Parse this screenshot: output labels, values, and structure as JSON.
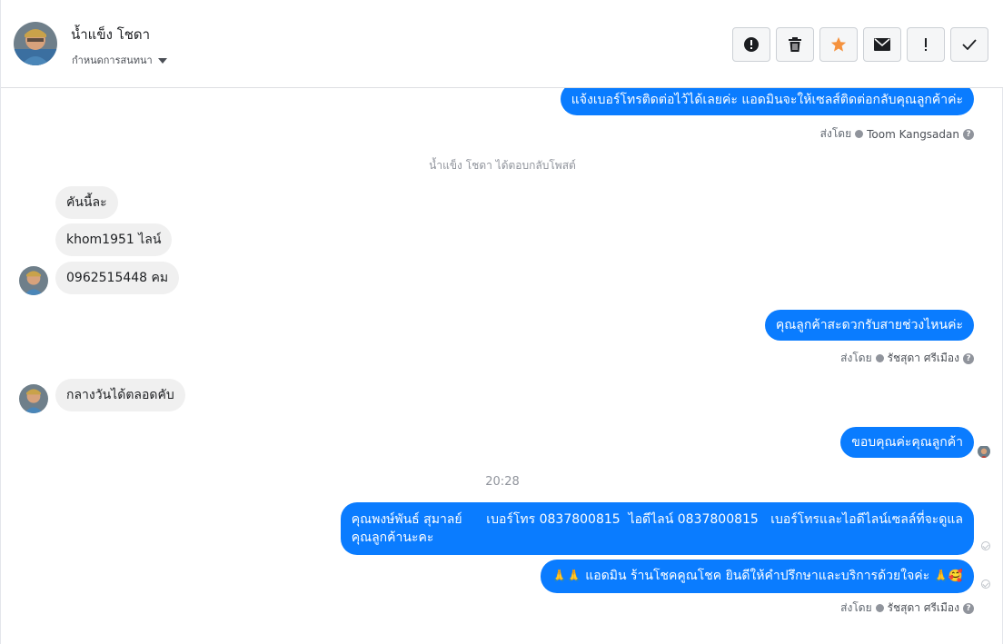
{
  "header": {
    "contact_name": "น้ำแข็ง โชดา",
    "label_setting": "กำหนดการสนทนา",
    "toolbar": [
      {
        "name": "report-spam",
        "icon": "alert-circle-icon"
      },
      {
        "name": "delete",
        "icon": "trash-icon"
      },
      {
        "name": "star",
        "icon": "star-icon"
      },
      {
        "name": "mark-unread",
        "icon": "envelope-icon"
      },
      {
        "name": "mark-important",
        "icon": "exclamation-icon"
      },
      {
        "name": "mark-done",
        "icon": "checkmark-icon"
      }
    ]
  },
  "messages": {
    "m1_text": "แจ้งเบอร์โทรติดต่อไว้ได้เลยค่ะ แอดมินจะให้เซลส์ติดต่อกลับคุณลูกค้าค่ะ",
    "m1_sent_by_label": "ส่งโดย",
    "m1_agent": "Toom Kangsadan",
    "post_reply_note": "น้ำแข็ง โชดา ได้ตอบกลับโพสต์",
    "in1": "คันนี้ละ",
    "in2": "khom1951 ไลน์",
    "in3": "0962515448 คม",
    "m2_text": "คุณลูกค้าสะดวกรับสายช่วงไหนค่ะ",
    "m2_sent_by_label": "ส่งโดย",
    "m2_agent": "รัชสุดา ศรีเมือง",
    "in4": "กลางวันได้ตลอดคับ",
    "m3_text": "ขอบคุณค่ะคุณลูกค้า",
    "timestamp": "20:28",
    "m4_line1": "คุณพงษ์พันธ์ สุมาลย์      เบอร์โทร 0837800815  ไอดีไลน์ 0837800815   เบอร์โทรและไอดีไลน์เซลล์ที่จะดูแล",
    "m4_line2": "คุณลูกค้านะคะ",
    "m5_emoji_left": "🙏🙏",
    "m5_text": "แอดมิน ร้านโชคคูณโชค ยินดีให้คำปรึกษาและบริการด้วยใจค่ะ",
    "m5_emoji_right": "🙏🥰",
    "m5_sent_by_label": "ส่งโดย",
    "m5_agent": "รัชสุดา ศรีเมือง"
  },
  "colors": {
    "outgoing_bubble": "#0a7cff",
    "incoming_bubble": "#f0f0f0",
    "star": "#f5923e"
  }
}
